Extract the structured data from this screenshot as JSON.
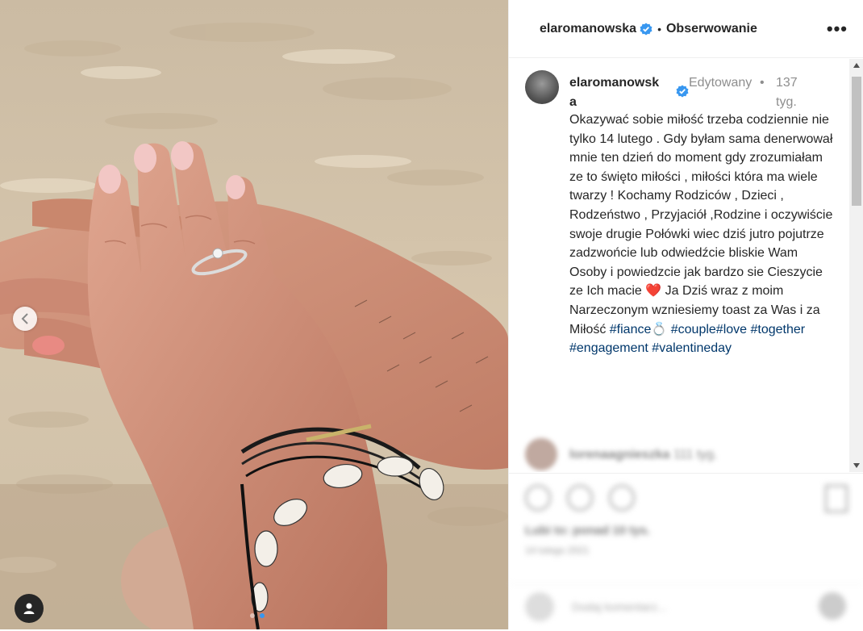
{
  "post": {
    "username": "elaromanowska",
    "follow_label": "Obserwowanie",
    "more_label": "•••",
    "separator": "•"
  },
  "caption": {
    "username": "elaromanowska",
    "edited": "Edytowany",
    "separator": "•",
    "age": "137 tyg.",
    "text_main": "Okazywać sobie miłość trzeba codziennie nie tylko 14 lutego . Gdy byłam sama denerwował mnie ten dzień do moment gdy zrozumiałam ze to święto miłości , miłości która ma wiele twarzy ! Kochamy Rodziców , Dzieci , Rodzeństwo , Przyjaciół ,Rodzine i oczywiście swoje drugie Połówki wiec dziś jutro pojutrze zadzwońcie lub odwiedźcie bliskie Wam Osoby i powiedzcie jak bardzo sie Cieszycie ze Ich macie ",
    "heart": "❤️",
    "text_tail": " Ja Dziś wraz z moim Narzeczonym wzniesiemy toast za Was i za Miłość ",
    "hashtags": [
      "#fiance💍",
      " #couple",
      "#love",
      " #together",
      " #engagement",
      " #valentineday"
    ]
  },
  "blurred_comment": {
    "username": "lorenaagnieszka",
    "age": "111 tyg."
  },
  "blurred_actions": {
    "likes": "Lubi to: ponad 10 tys.",
    "date": "14 lutego 2021",
    "comment_placeholder": "Dodaj komentarz..."
  },
  "colors": {
    "verified": "#3897f0",
    "hashtag": "#00376b",
    "muted": "#8e8e8e"
  }
}
